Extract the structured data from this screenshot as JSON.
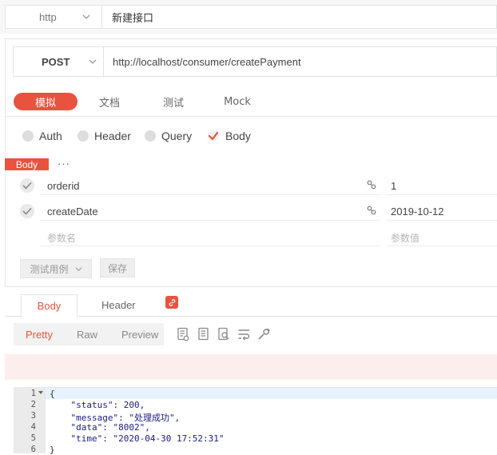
{
  "top": {
    "protocol": "http",
    "api_name": "新建接口"
  },
  "request": {
    "method": "POST",
    "url": "http://localhost/consumer/createPayment",
    "tabs": [
      {
        "label": "模拟",
        "active": true
      },
      {
        "label": "文档",
        "active": false
      },
      {
        "label": "测试",
        "active": false
      },
      {
        "label": "Mock",
        "active": false
      }
    ],
    "param_types": [
      {
        "label": "Auth",
        "checked": false
      },
      {
        "label": "Header",
        "checked": false
      },
      {
        "label": "Query",
        "checked": false
      },
      {
        "label": "Body",
        "checked": true
      }
    ],
    "body_label": "Body",
    "more": "···",
    "params": [
      {
        "key": "orderid",
        "value": "1"
      },
      {
        "key": "createDate",
        "value": "2019-10-12"
      }
    ],
    "key_placeholder": "参数名",
    "value_placeholder": "参数值",
    "test_case_label": "测试用例",
    "save_label": "保存"
  },
  "response": {
    "tabs": [
      {
        "label": "Body",
        "active": true
      },
      {
        "label": "Header",
        "active": false
      }
    ],
    "formats": [
      {
        "label": "Pretty",
        "active": true
      },
      {
        "label": "Raw",
        "active": false
      },
      {
        "label": "Preview",
        "active": false
      }
    ],
    "code_lines": [
      "{",
      "    \"status\": 200,",
      "    \"message\": \"处理成功\",",
      "    \"data\": \"8002\",",
      "    \"time\": \"2020-04-30 17:52:31\"",
      "}"
    ],
    "line_numbers": [
      "1",
      "2",
      "3",
      "4",
      "5",
      "6"
    ]
  },
  "colors": {
    "accent": "#e8533f"
  }
}
